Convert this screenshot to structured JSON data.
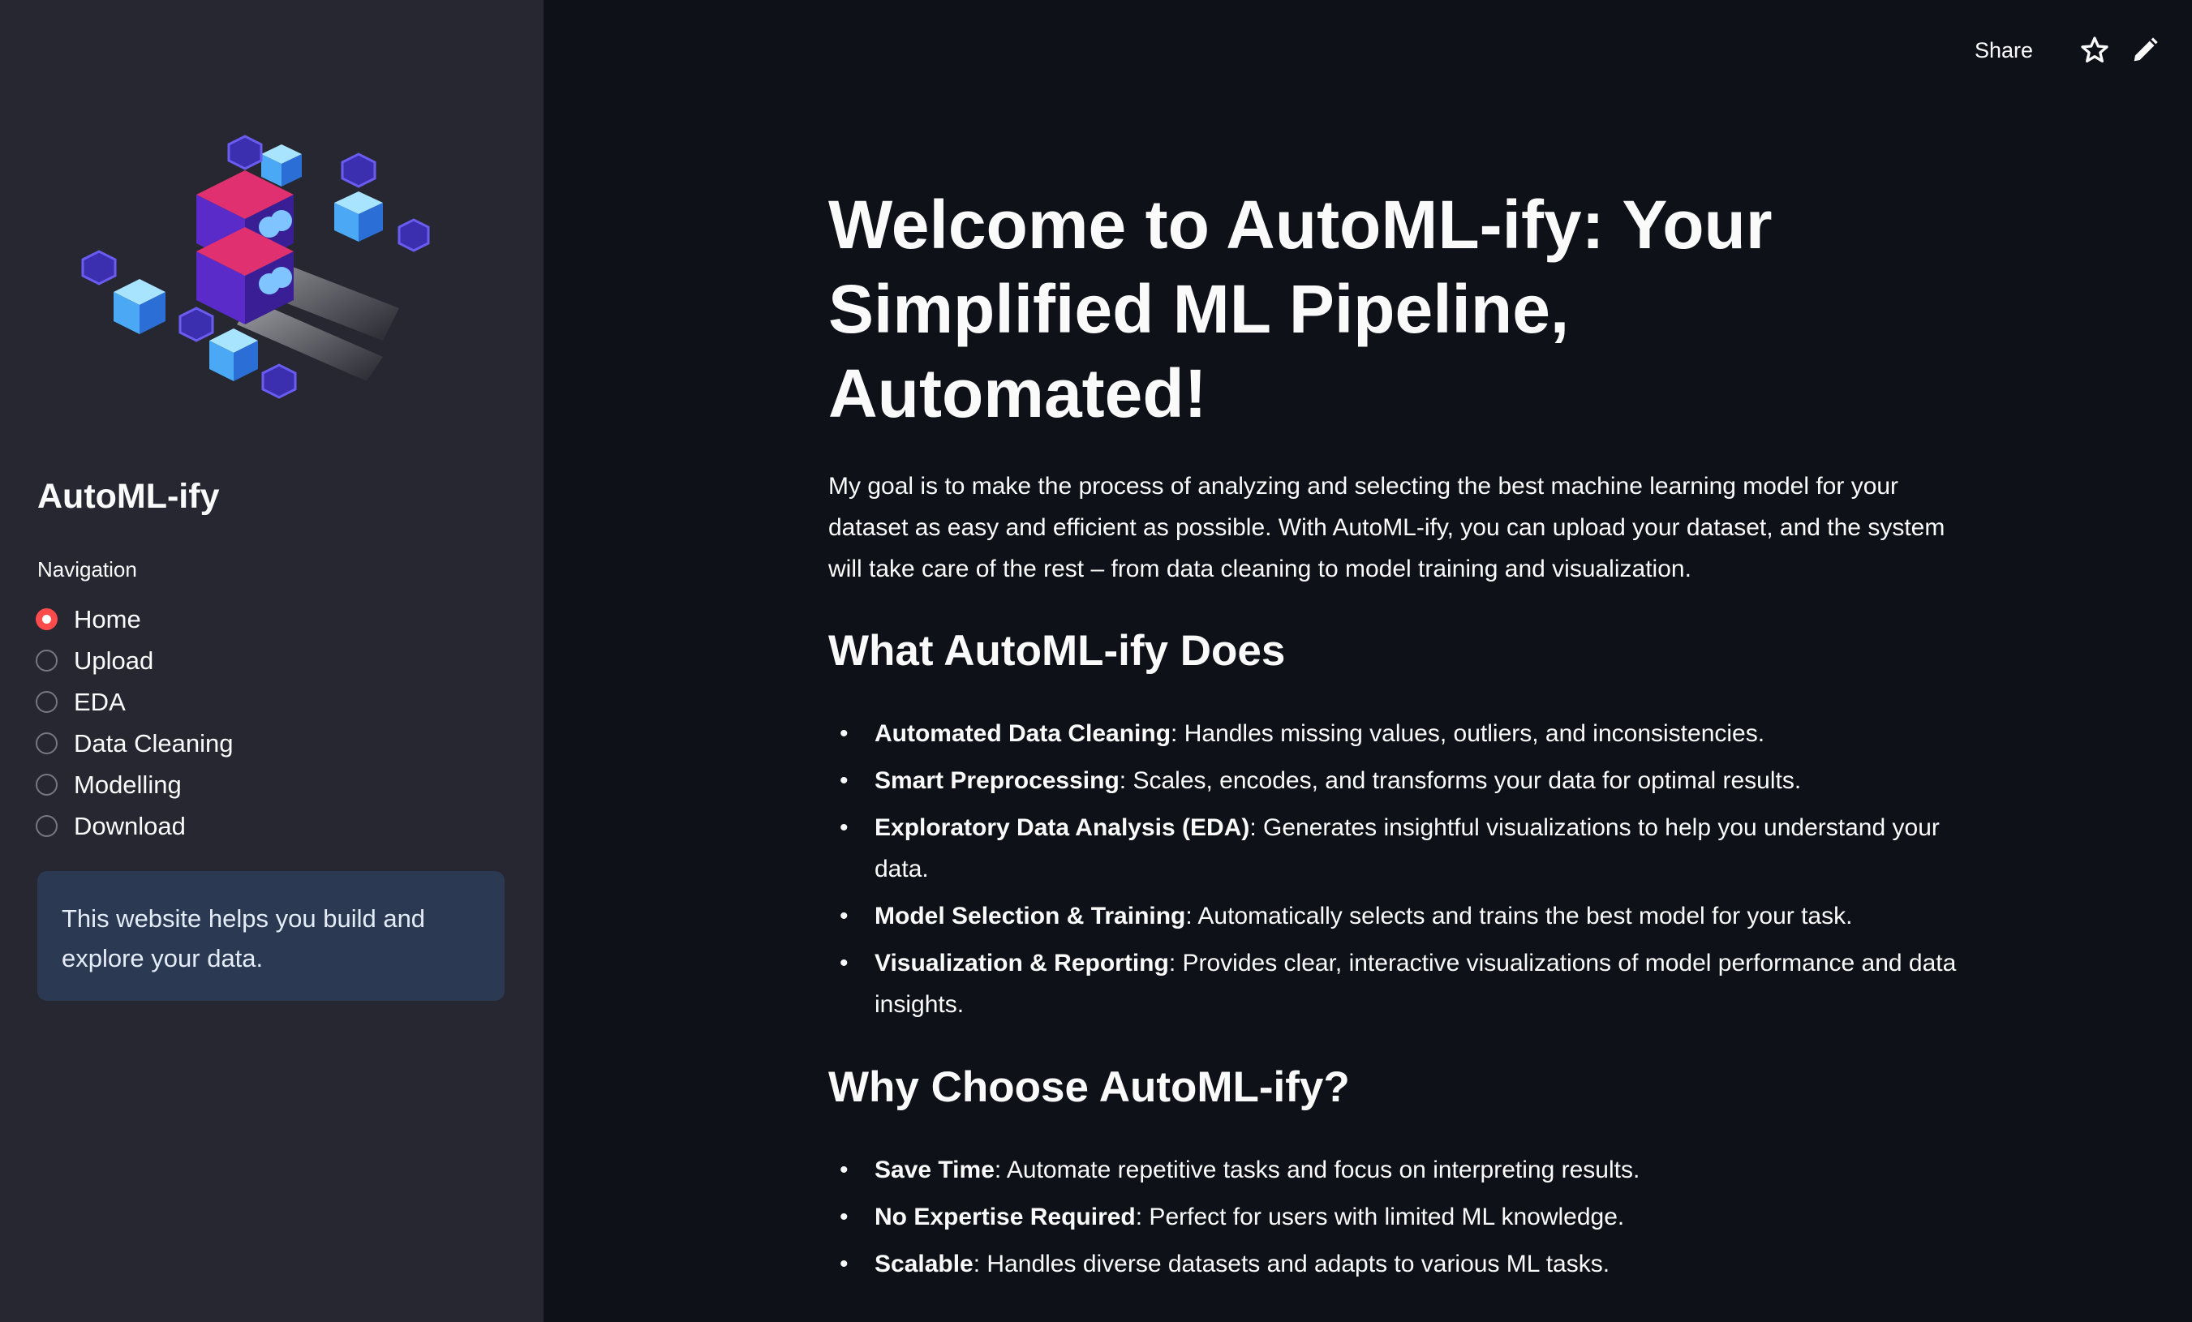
{
  "sidebar": {
    "app_title": "AutoML-ify",
    "nav_label": "Navigation",
    "nav_items": [
      {
        "label": "Home",
        "selected": true
      },
      {
        "label": "Upload",
        "selected": false
      },
      {
        "label": "EDA",
        "selected": false
      },
      {
        "label": "Data Cleaning",
        "selected": false
      },
      {
        "label": "Modelling",
        "selected": false
      },
      {
        "label": "Download",
        "selected": false
      }
    ],
    "info_text": "This website helps you build and explore your data."
  },
  "toolbar": {
    "share_label": "Share",
    "icons": [
      "star-icon",
      "pencil-icon"
    ]
  },
  "main": {
    "title": "Welcome to AutoML-ify: Your Simplified ML Pipeline, Automated!",
    "intro": "My goal is to make the process of analyzing and selecting the best machine learning model for your dataset as easy and efficient as possible. With AutoML-ify, you can upload your dataset, and the system will take care of the rest – from data cleaning to model training and visualization.",
    "section1": {
      "heading": "What AutoML-ify Does",
      "items": [
        {
          "term": "Automated Data Cleaning",
          "desc": ": Handles missing values, outliers, and inconsistencies."
        },
        {
          "term": "Smart Preprocessing",
          "desc": ": Scales, encodes, and transforms your data for optimal results."
        },
        {
          "term": "Exploratory Data Analysis (EDA)",
          "desc": ": Generates insightful visualizations to help you understand your data."
        },
        {
          "term": "Model Selection & Training",
          "desc": ": Automatically selects and trains the best model for your task."
        },
        {
          "term": "Visualization & Reporting",
          "desc": ": Provides clear, interactive visualizations of model performance and data insights."
        }
      ]
    },
    "section2": {
      "heading": "Why Choose AutoML-ify?",
      "items": [
        {
          "term": "Save Time",
          "desc": ": Automate repetitive tasks and focus on interpreting results."
        },
        {
          "term": "No Expertise Required",
          "desc": ": Perfect for users with limited ML knowledge."
        },
        {
          "term": "Scalable",
          "desc": ": Handles diverse datasets and adapts to various ML tasks."
        }
      ]
    }
  },
  "colors": {
    "background": "#0e1117",
    "sidebar": "#262730",
    "accent": "#ff4b4b",
    "info_box": "#2b3a52"
  }
}
